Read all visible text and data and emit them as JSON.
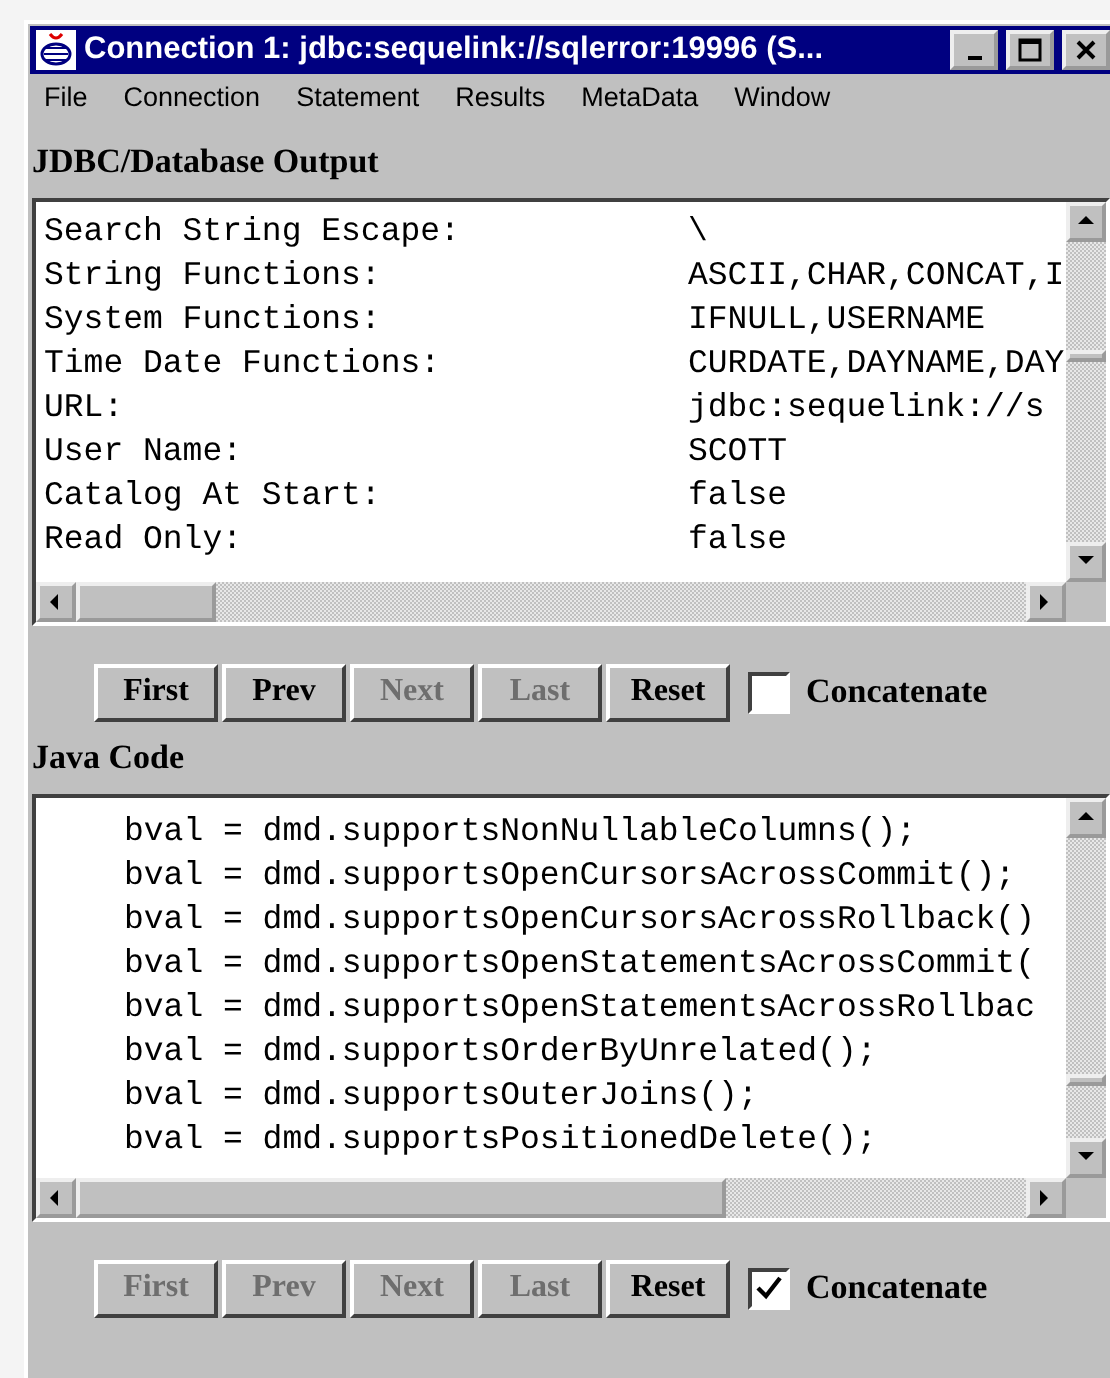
{
  "window": {
    "title": "Connection 1: jdbc:sequelink://sqlerror:19996 (S..."
  },
  "menu": [
    "File",
    "Connection",
    "Statement",
    "Results",
    "MetaData",
    "Window"
  ],
  "panels": [
    {
      "heading": "JDBC/Database Output",
      "kind": "table",
      "rows": [
        {
          "label": "Search String Escape:",
          "value": "\\"
        },
        {
          "label": "String Functions:",
          "value": "ASCII,CHAR,CONCAT,I"
        },
        {
          "label": "System Functions:",
          "value": "IFNULL,USERNAME"
        },
        {
          "label": "Time Date Functions:",
          "value": "CURDATE,DAYNAME,DAY"
        },
        {
          "label": "URL:",
          "value": "jdbc:sequelink://s"
        },
        {
          "label": "User Name:",
          "value": "SCOTT"
        },
        {
          "label": "Catalog At Start:",
          "value": "false"
        },
        {
          "label": "Read Only:",
          "value": "false"
        }
      ],
      "buttons": [
        {
          "label": "First",
          "disabled": false
        },
        {
          "label": "Prev",
          "disabled": false
        },
        {
          "label": "Next",
          "disabled": true
        },
        {
          "label": "Last",
          "disabled": true
        },
        {
          "label": "Reset",
          "disabled": false
        }
      ],
      "concatenate": {
        "label": "Concatenate",
        "checked": false
      }
    },
    {
      "heading": "Java Code",
      "kind": "code",
      "lines": [
        "bval = dmd.supportsNonNullableColumns();",
        "bval = dmd.supportsOpenCursorsAcrossCommit();",
        "bval = dmd.supportsOpenCursorsAcrossRollback()",
        "bval = dmd.supportsOpenStatementsAcrossCommit(",
        "bval = dmd.supportsOpenStatementsAcrossRollbac",
        "bval = dmd.supportsOrderByUnrelated();",
        "bval = dmd.supportsOuterJoins();",
        "bval = dmd.supportsPositionedDelete();"
      ],
      "buttons": [
        {
          "label": "First",
          "disabled": true
        },
        {
          "label": "Prev",
          "disabled": true
        },
        {
          "label": "Next",
          "disabled": true
        },
        {
          "label": "Last",
          "disabled": true
        },
        {
          "label": "Reset",
          "disabled": false
        }
      ],
      "concatenate": {
        "label": "Concatenate",
        "checked": true
      }
    }
  ]
}
